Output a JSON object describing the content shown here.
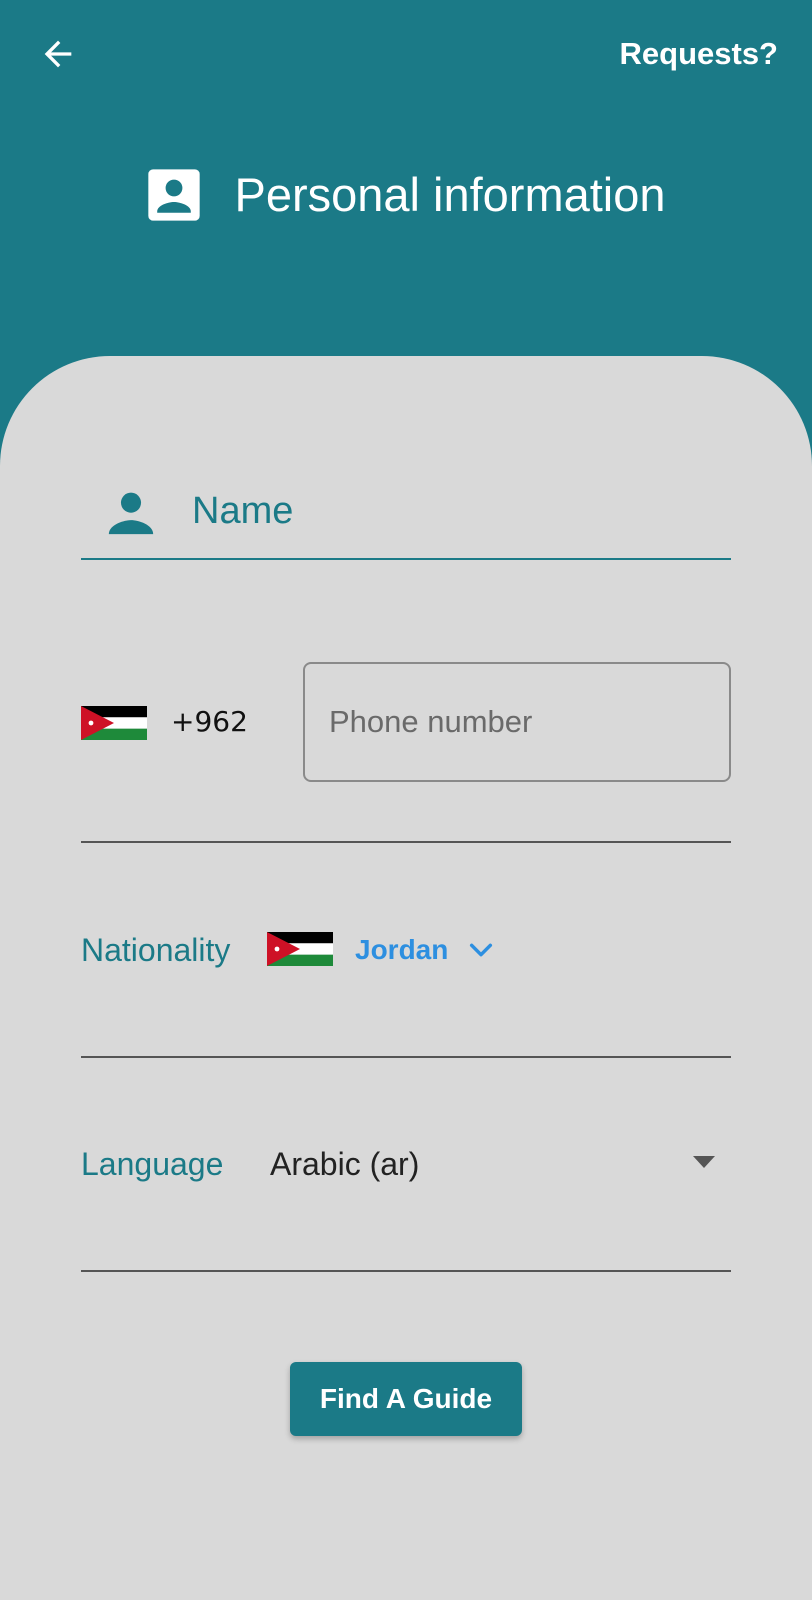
{
  "header": {
    "back_icon": "arrow-back-icon",
    "requests_label": "Requests?",
    "title": "Personal information",
    "title_icon": "account-box-icon"
  },
  "form": {
    "name": {
      "icon": "person-icon",
      "label": "Name"
    },
    "phone": {
      "flag_icon": "jordan-flag-icon",
      "dial_code": "+962",
      "placeholder": "Phone number"
    },
    "nationality": {
      "label": "Nationality",
      "flag_icon": "jordan-flag-icon",
      "value": "Jordan",
      "chevron_icon": "chevron-down-icon"
    },
    "language": {
      "label": "Language",
      "value": "Arabic (ar)",
      "caret_icon": "dropdown-caret-icon"
    },
    "submit_label": "Find A Guide"
  },
  "colors": {
    "primary": "#1b7a87",
    "card_background": "#d9d9d9",
    "link_blue": "#2d8fe0"
  }
}
